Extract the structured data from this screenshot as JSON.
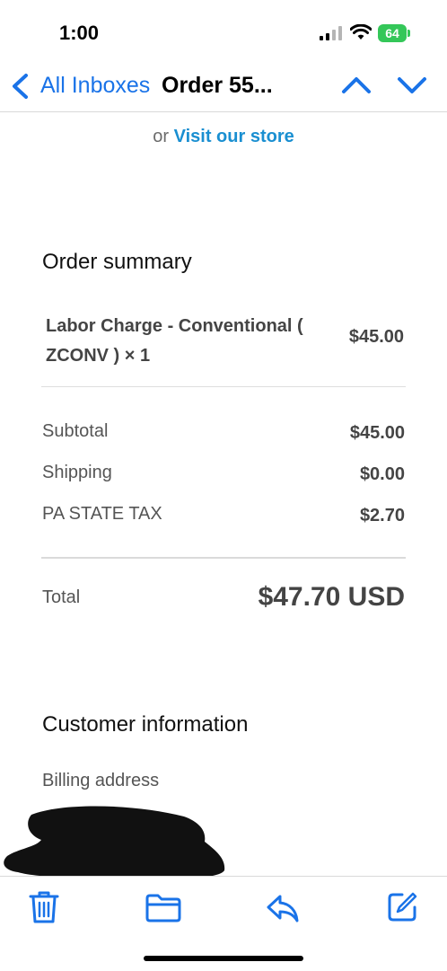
{
  "status_bar": {
    "time": "1:00",
    "battery": "64"
  },
  "nav": {
    "back_label": "All Inboxes",
    "title": "Order 55..."
  },
  "content": {
    "store_or": "or ",
    "store_link": "Visit our store",
    "order_summary": {
      "title": "Order summary",
      "item": {
        "name": "Labor Charge - Conventional ( ZCONV ) × 1",
        "price": "$45.00"
      },
      "subtotal": {
        "label": "Subtotal",
        "value": "$45.00"
      },
      "shipping": {
        "label": "Shipping",
        "value": "$0.00"
      },
      "tax": {
        "label": "PA STATE TAX",
        "value": "$2.70"
      },
      "total": {
        "label": "Total",
        "value": "$47.70 USD"
      }
    },
    "customer_information": {
      "title": "Customer information",
      "billing_label": "Billing address"
    }
  },
  "toolbar": {
    "icons": [
      "trash-icon",
      "folder-icon",
      "reply-icon",
      "compose-icon"
    ]
  },
  "colors": {
    "accent": "#1a73e8",
    "link": "#1a8fd1",
    "battery": "#34c759"
  }
}
